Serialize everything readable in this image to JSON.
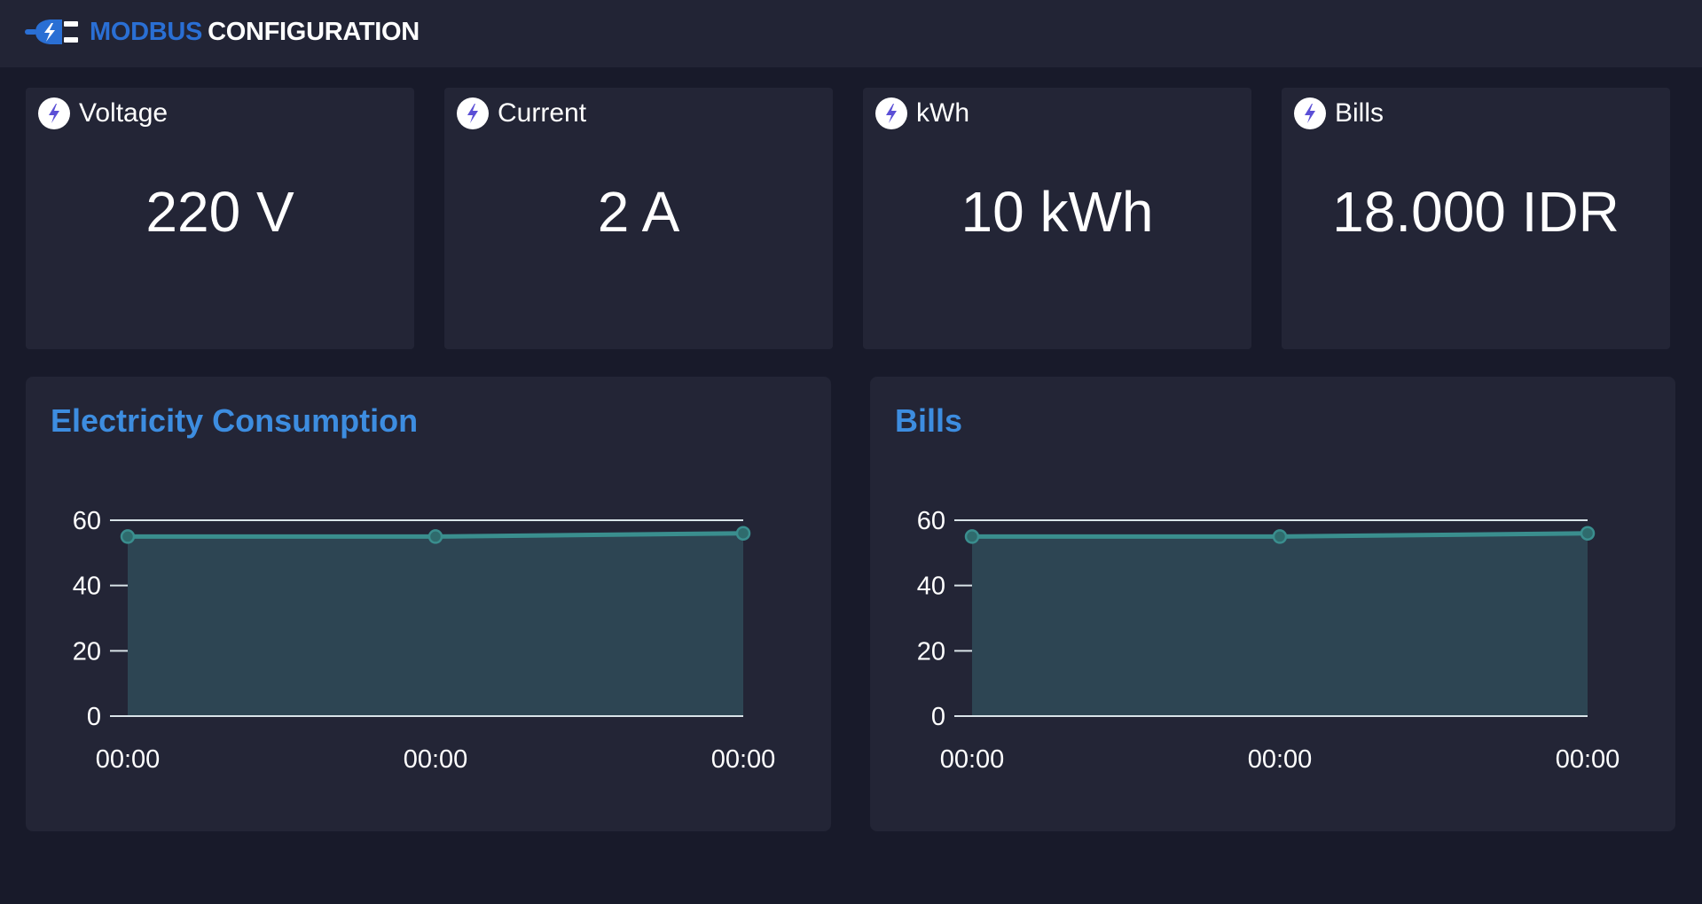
{
  "header": {
    "brand_part1": "MODBUS",
    "brand_part2": "CONFIGURATION",
    "logo_icon": "power-plug-bolt-icon",
    "accent_color": "#2a6fd4"
  },
  "stats": [
    {
      "label": "Voltage",
      "value": "220 V",
      "icon": "bolt-icon"
    },
    {
      "label": "Current",
      "value": "2 A",
      "icon": "bolt-icon"
    },
    {
      "label": "kWh",
      "value": "10 kWh",
      "icon": "bolt-icon"
    },
    {
      "label": "Bills",
      "value": "18.000 IDR",
      "icon": "bolt-icon"
    }
  ],
  "charts": {
    "consumption": {
      "title": "Electricity Consumption"
    },
    "bills": {
      "title": "Bills"
    }
  },
  "chart_data": [
    {
      "type": "area",
      "title": "Electricity Consumption",
      "x": [
        "00:00",
        "00:00",
        "00:00"
      ],
      "series": [
        {
          "values": [
            55,
            55,
            56
          ],
          "color": "#3a8e8e"
        }
      ],
      "yticks": [
        0,
        20,
        40,
        60
      ],
      "ylim": [
        0,
        60
      ],
      "grid": true,
      "xlabel": "",
      "ylabel": ""
    },
    {
      "type": "area",
      "title": "Bills",
      "x": [
        "00:00",
        "00:00",
        "00:00"
      ],
      "series": [
        {
          "values": [
            55,
            55,
            56
          ],
          "color": "#3a8e8e"
        }
      ],
      "yticks": [
        0,
        20,
        40,
        60
      ],
      "ylim": [
        0,
        60
      ],
      "grid": true,
      "xlabel": "",
      "ylabel": ""
    }
  ]
}
